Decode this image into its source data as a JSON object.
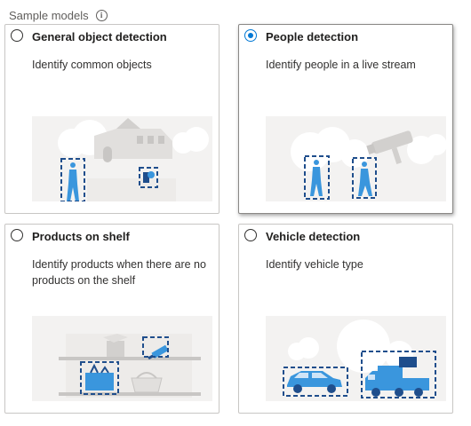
{
  "section": {
    "title": "Sample models",
    "info_icon": "info-icon"
  },
  "colors": {
    "accent": "#0078d4",
    "illustration_blue": "#3a96dd",
    "dashed_box": "#1f4e8c"
  },
  "selected_model": "People detection",
  "cards": [
    {
      "title": "General object detection",
      "description": "Identify common objects",
      "checked": false,
      "illustration_icon": "objects-illustration-icon"
    },
    {
      "title": "People detection",
      "description": "Identify people in a live stream",
      "checked": true,
      "illustration_icon": "people-camera-illustration-icon"
    },
    {
      "title": "Products on shelf",
      "description": "Identify products when there are no products on the shelf",
      "checked": false,
      "illustration_icon": "shelf-products-illustration-icon"
    },
    {
      "title": "Vehicle detection",
      "description": "Identify vehicle type",
      "checked": false,
      "illustration_icon": "vehicles-illustration-icon"
    }
  ]
}
